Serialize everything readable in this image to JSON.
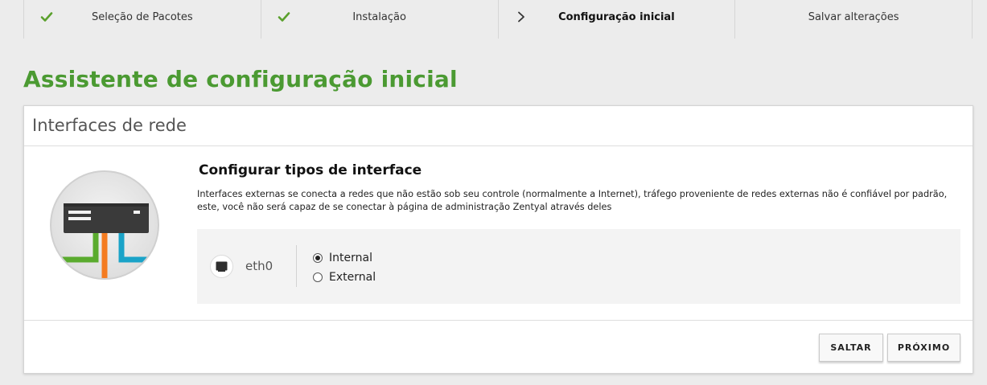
{
  "steps": [
    {
      "label": "Seleção de Pacotes",
      "status": "done",
      "icon": "check-icon"
    },
    {
      "label": "Instalação",
      "status": "done",
      "icon": "check-icon"
    },
    {
      "label": "Configuração inicial",
      "status": "active",
      "icon": "chevron-right-icon"
    },
    {
      "label": "Salvar alterações",
      "status": "pending",
      "icon": ""
    }
  ],
  "page": {
    "title": "Assistente de configuração inicial"
  },
  "card": {
    "title": "Interfaces de rede",
    "section_title": "Configurar tipos de interface",
    "description": "Interfaces externas se conecta a redes que não estão sob seu controle (normalmente a Internet), tráfego proveniente de redes externas não é confiável por padrão, este, você não será capaz de se conectar à página de administração Zentyal através deles",
    "interface": {
      "name": "eth0",
      "options": [
        {
          "label": "Internal",
          "checked": true
        },
        {
          "label": "External",
          "checked": false
        }
      ]
    },
    "buttons": {
      "skip": "SALTAR",
      "next": "PRÓXIMO"
    }
  },
  "colors": {
    "accent_green": "#4b9a32",
    "check_green": "#5aa02c",
    "cable_green": "#5aab2e",
    "cable_orange": "#f47b20",
    "cable_blue": "#1aa3c8"
  }
}
